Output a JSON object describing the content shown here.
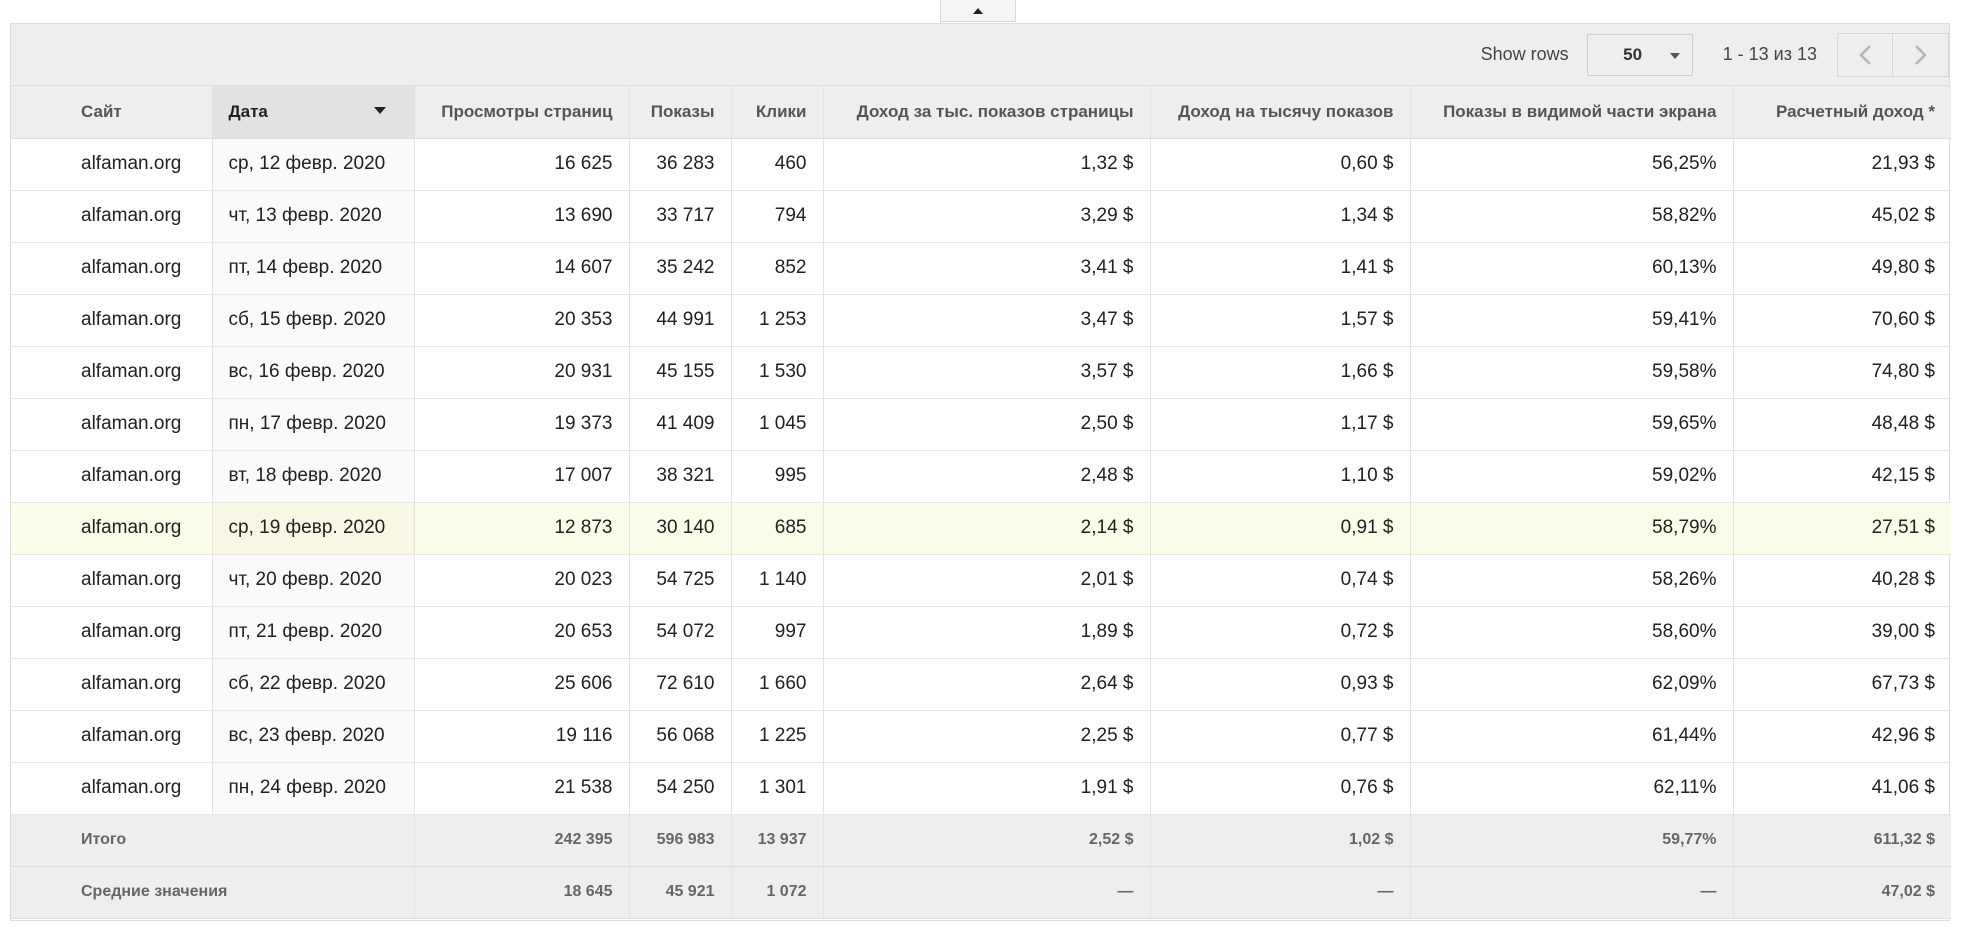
{
  "toolbar": {
    "show_rows_label": "Show rows",
    "rows_value": "50",
    "range_text": "1 - 13 из 13"
  },
  "icons": {
    "collapse": "caret-up-icon",
    "prev": "chevron-left-icon",
    "next": "chevron-right-icon",
    "select": "caret-down-icon",
    "sort": "sort-desc-icon"
  },
  "colors": {
    "header_bg": "#eeeeee",
    "sorted_header_bg": "#e2e2e2",
    "highlight_row_bg": "#fbfbea"
  },
  "table": {
    "columns": [
      "Сайт",
      "Дата",
      "Просмотры страниц",
      "Показы",
      "Клики",
      "Доход за тыс. показов страницы",
      "Доход на тысячу показов",
      "Показы в видимой части экрана",
      "Расчетный доход *"
    ],
    "rows": [
      [
        "alfaman.org",
        "ср, 12 февр. 2020",
        "16 625",
        "36 283",
        "460",
        "1,32 $",
        "0,60 $",
        "56,25%",
        "21,93 $"
      ],
      [
        "alfaman.org",
        "чт, 13 февр. 2020",
        "13 690",
        "33 717",
        "794",
        "3,29 $",
        "1,34 $",
        "58,82%",
        "45,02 $"
      ],
      [
        "alfaman.org",
        "пт, 14 февр. 2020",
        "14 607",
        "35 242",
        "852",
        "3,41 $",
        "1,41 $",
        "60,13%",
        "49,80 $"
      ],
      [
        "alfaman.org",
        "сб, 15 февр. 2020",
        "20 353",
        "44 991",
        "1 253",
        "3,47 $",
        "1,57 $",
        "59,41%",
        "70,60 $"
      ],
      [
        "alfaman.org",
        "вс, 16 февр. 2020",
        "20 931",
        "45 155",
        "1 530",
        "3,57 $",
        "1,66 $",
        "59,58%",
        "74,80 $"
      ],
      [
        "alfaman.org",
        "пн, 17 февр. 2020",
        "19 373",
        "41 409",
        "1 045",
        "2,50 $",
        "1,17 $",
        "59,65%",
        "48,48 $"
      ],
      [
        "alfaman.org",
        "вт, 18 февр. 2020",
        "17 007",
        "38 321",
        "995",
        "2,48 $",
        "1,10 $",
        "59,02%",
        "42,15 $"
      ],
      [
        "alfaman.org",
        "ср, 19 февр. 2020",
        "12 873",
        "30 140",
        "685",
        "2,14 $",
        "0,91 $",
        "58,79%",
        "27,51 $"
      ],
      [
        "alfaman.org",
        "чт, 20 февр. 2020",
        "20 023",
        "54 725",
        "1 140",
        "2,01 $",
        "0,74 $",
        "58,26%",
        "40,28 $"
      ],
      [
        "alfaman.org",
        "пт, 21 февр. 2020",
        "20 653",
        "54 072",
        "997",
        "1,89 $",
        "0,72 $",
        "58,60%",
        "39,00 $"
      ],
      [
        "alfaman.org",
        "сб, 22 февр. 2020",
        "25 606",
        "72 610",
        "1 660",
        "2,64 $",
        "0,93 $",
        "62,09%",
        "67,73 $"
      ],
      [
        "alfaman.org",
        "вс, 23 февр. 2020",
        "19 116",
        "56 068",
        "1 225",
        "2,25 $",
        "0,77 $",
        "61,44%",
        "42,96 $"
      ],
      [
        "alfaman.org",
        "пн, 24 февр. 2020",
        "21 538",
        "54 250",
        "1 301",
        "1,91 $",
        "0,76 $",
        "62,11%",
        "41,06 $"
      ]
    ],
    "highlighted_row": 7,
    "totals": {
      "label": "Итого",
      "values": [
        "242 395",
        "596 983",
        "13 937",
        "2,52 $",
        "1,02 $",
        "59,77%",
        "611,32 $"
      ]
    },
    "averages": {
      "label": "Средние значения",
      "values": [
        "18 645",
        "45 921",
        "1 072",
        "—",
        "—",
        "—",
        "47,02 $"
      ]
    }
  }
}
